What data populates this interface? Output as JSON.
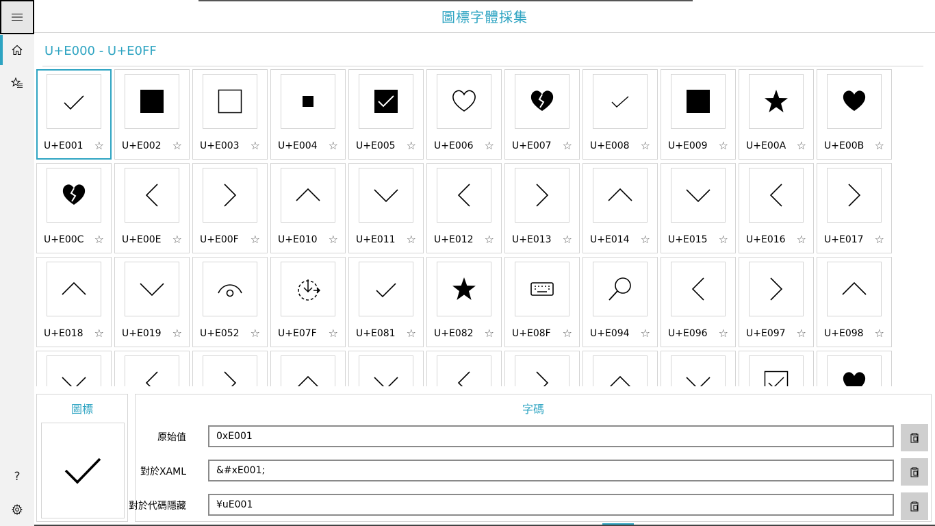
{
  "app": {
    "title": "圖標字體採集"
  },
  "rail": {
    "menu_icon": "hamburger-icon",
    "items": [
      {
        "name": "home",
        "icon": "home-icon",
        "active": true
      },
      {
        "name": "favorites",
        "icon": "star-list-icon",
        "active": false
      }
    ],
    "bottom": [
      {
        "name": "help",
        "icon": "question-icon",
        "glyph": "?"
      },
      {
        "name": "settings",
        "icon": "gear-icon"
      }
    ]
  },
  "range": {
    "label": "U+E000 - U+E0FF"
  },
  "favorite_glyph": "☆",
  "glyphs": [
    {
      "code": "U+E001",
      "icon": "check"
    },
    {
      "code": "U+E002",
      "icon": "square-filled"
    },
    {
      "code": "U+E003",
      "icon": "square-outline"
    },
    {
      "code": "U+E004",
      "icon": "square-small"
    },
    {
      "code": "U+E005",
      "icon": "checkbox-checked"
    },
    {
      "code": "U+E006",
      "icon": "heart-outline"
    },
    {
      "code": "U+E007",
      "icon": "heart-broken"
    },
    {
      "code": "U+E008",
      "icon": "check-small"
    },
    {
      "code": "U+E009",
      "icon": "square-filled"
    },
    {
      "code": "U+E00A",
      "icon": "star-filled"
    },
    {
      "code": "U+E00B",
      "icon": "heart-filled"
    },
    {
      "code": "U+E00C",
      "icon": "heart-broken"
    },
    {
      "code": "U+E00E",
      "icon": "chevron-left"
    },
    {
      "code": "U+E00F",
      "icon": "chevron-right"
    },
    {
      "code": "U+E010",
      "icon": "chevron-up"
    },
    {
      "code": "U+E011",
      "icon": "chevron-down"
    },
    {
      "code": "U+E012",
      "icon": "chevron-left"
    },
    {
      "code": "U+E013",
      "icon": "chevron-right"
    },
    {
      "code": "U+E014",
      "icon": "chevron-up"
    },
    {
      "code": "U+E015",
      "icon": "chevron-down"
    },
    {
      "code": "U+E016",
      "icon": "chevron-left"
    },
    {
      "code": "U+E017",
      "icon": "chevron-right"
    },
    {
      "code": "U+E018",
      "icon": "chevron-up"
    },
    {
      "code": "U+E019",
      "icon": "chevron-down"
    },
    {
      "code": "U+E052",
      "icon": "eye"
    },
    {
      "code": "U+E07F",
      "icon": "sync-download"
    },
    {
      "code": "U+E081",
      "icon": "check"
    },
    {
      "code": "U+E082",
      "icon": "star-filled"
    },
    {
      "code": "U+E08F",
      "icon": "keyboard"
    },
    {
      "code": "U+E094",
      "icon": "search"
    },
    {
      "code": "U+E096",
      "icon": "chevron-left"
    },
    {
      "code": "U+E097",
      "icon": "chevron-right"
    },
    {
      "code": "U+E098",
      "icon": "chevron-up"
    },
    {
      "code": "",
      "icon": "chevron-down"
    },
    {
      "code": "",
      "icon": "chevron-left"
    },
    {
      "code": "",
      "icon": "chevron-right"
    },
    {
      "code": "",
      "icon": "chevron-up"
    },
    {
      "code": "",
      "icon": "chevron-down"
    },
    {
      "code": "",
      "icon": "chevron-left"
    },
    {
      "code": "",
      "icon": "chevron-right"
    },
    {
      "code": "",
      "icon": "chevron-up"
    },
    {
      "code": "",
      "icon": "chevron-down"
    },
    {
      "code": "",
      "icon": "checkbox-checked-outline"
    },
    {
      "code": "",
      "icon": "heart-filled"
    }
  ],
  "selected_index": 0,
  "detail": {
    "icon_header": "圖標",
    "code_header": "字碼",
    "preview_icon": "check",
    "rows": [
      {
        "label": "原始值",
        "value": "0xE001",
        "copy_icon": "clipboard-icon"
      },
      {
        "label": "對於XAML",
        "value": "&#xE001;",
        "copy_icon": "clipboard-icon"
      },
      {
        "label": "對於代碼隱藏",
        "value": "¥uE001",
        "copy_icon": "clipboard-icon"
      }
    ]
  }
}
